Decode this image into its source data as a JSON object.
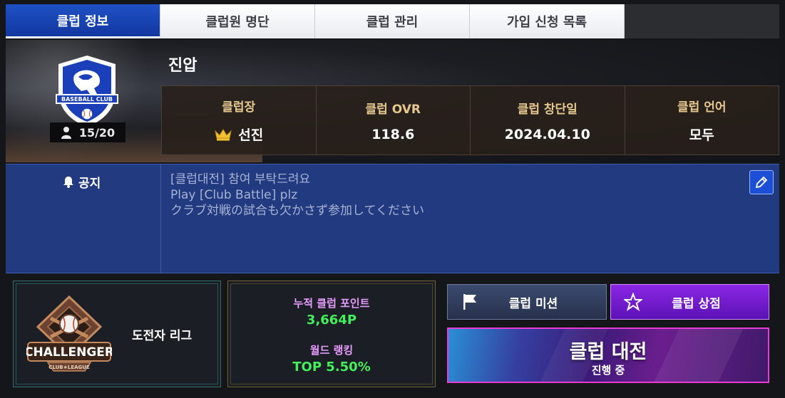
{
  "tabs": [
    {
      "label": "클럽 정보",
      "active": true
    },
    {
      "label": "클럽원 명단",
      "active": false
    },
    {
      "label": "클럽 관리",
      "active": false
    },
    {
      "label": "가입 신청 목록",
      "active": false
    }
  ],
  "club": {
    "name": "진압",
    "emblem_text": "BASEBALL CLUB",
    "members": "15/20",
    "stats": [
      {
        "label": "클럽장",
        "value": "선진",
        "icon": "crown-icon"
      },
      {
        "label": "클럽 OVR",
        "value": "118.6"
      },
      {
        "label": "클럽 창단일",
        "value": "2024.04.10"
      },
      {
        "label": "클럽 언어",
        "value": "모두"
      }
    ]
  },
  "notice": {
    "title": "공지",
    "lines": [
      "[클럽대전] 참여 부탁드려요",
      "Play [Club Battle] plz",
      "クラブ対戦の試合も欠かさず参加してください"
    ]
  },
  "league": {
    "emblem_text": "CHALLENGER",
    "emblem_sub": "CLUB★LEAGUE",
    "name": "도전자 리그"
  },
  "points": {
    "label": "누적 클럽 포인트",
    "value": "3,664P",
    "rank_label": "월드 랭킹",
    "rank_value": "TOP 5.50%"
  },
  "buttons": {
    "mission": "클럽 미션",
    "shop": "클럽 상점"
  },
  "battle": {
    "title": "클럽 대전",
    "status": "진행 중"
  },
  "colors": {
    "tab_active": "#1f51c4",
    "notice_bg": "#213a80",
    "stat_label": "#e6c88f",
    "points_label": "#e79bff",
    "points_value": "#41f05a",
    "shop_button": "#8c26e6",
    "battle_border": "#e83bd4"
  }
}
